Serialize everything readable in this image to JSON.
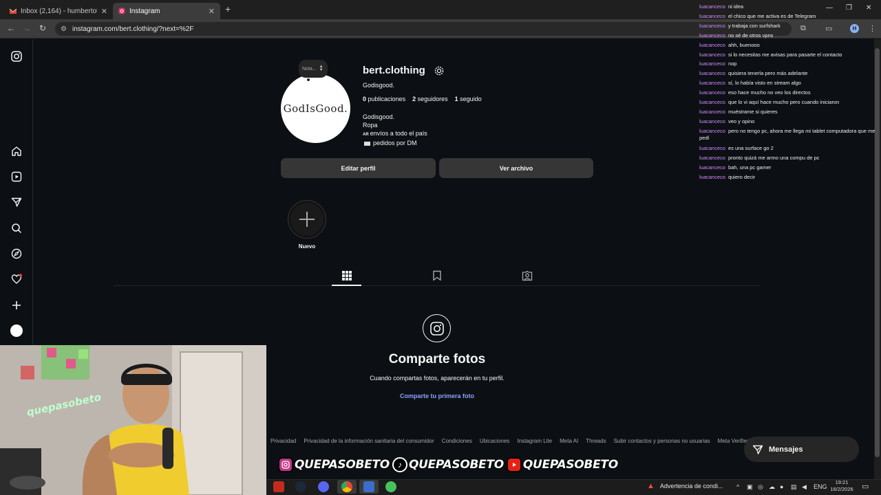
{
  "browser": {
    "tabs": [
      {
        "title": "Inbox (2,164) - humbertotutive..."
      },
      {
        "title": "Instagram"
      }
    ],
    "url": "instagram.com/bert.clothing/?next=%2F",
    "profile_initial": "H"
  },
  "profile": {
    "note": "Nota...",
    "avatar_text": "GodIsGood.",
    "username": "bert.clothing",
    "full_name": "Godisgood.",
    "stats": {
      "posts_count": "0",
      "posts_label": "publicaciones",
      "followers_count": "2",
      "followers_label": "seguidores",
      "following_count": "1",
      "following_label": "seguido"
    },
    "bio": {
      "line1": "Godisgood.",
      "line2": "Ropa",
      "flag": "AR",
      "line3": "envíos a todo el país",
      "line4": "pedidos por DM"
    },
    "edit_button": "Editar perfil",
    "archive_button": "Ver archivo",
    "new_highlight_label": "Nuevo"
  },
  "empty_state": {
    "title": "Comparte fotos",
    "subtitle": "Cuando compartas fotos, aparecerán en tu perfil.",
    "link": "Comparte tu primera foto"
  },
  "footer_links": [
    "Privacidad",
    "Privacidad de la información sanitaria del consumidor",
    "Condiciones",
    "Ubicaciones",
    "Instagram Lite",
    "Meta AI",
    "Threads",
    "Subir contactos y personas no usuarias",
    "Meta Verified"
  ],
  "messages_button": "Mensajes",
  "chat": [
    {
      "user": "luacanceco",
      "msg": "ni idea"
    },
    {
      "user": "luacanceco",
      "msg": "el chico que me activa es de Telegram"
    },
    {
      "user": "luacanceco",
      "msg": "y trabaja con surfshark"
    },
    {
      "user": "luacanceco",
      "msg": "no sé de otros vpns"
    },
    {
      "user": "luacanceco",
      "msg": "ahh, buenooo"
    },
    {
      "user": "luacanceco",
      "msg": "si lo necesitas me avisas para pasarte el contacto"
    },
    {
      "user": "luacanceco",
      "msg": "nop"
    },
    {
      "user": "luacanceco",
      "msg": "quisiera tenerla pero más adelante"
    },
    {
      "user": "luacanceco",
      "msg": "sí, lo había visto en stream algo"
    },
    {
      "user": "luacanceco",
      "msg": "eso hace mucho no veo los directos"
    },
    {
      "user": "luacanceco",
      "msg": "que lo vi aquí hace mucho pero cuando iniciaron"
    },
    {
      "user": "luacanceco",
      "msg": "muéstrame si quieres"
    },
    {
      "user": "luacanceco",
      "msg": "veo y opino"
    },
    {
      "user": "luacanceco",
      "msg": "pero no tengo pc, ahora me llega mi tablet computadora que me pedí"
    },
    {
      "user": "luacanceco",
      "msg": "es una surface go 2"
    },
    {
      "user": "luacanceco",
      "msg": "pronto quizá me armo una compu de pc"
    },
    {
      "user": "luacanceco",
      "msg": "bah, una pc gamer"
    },
    {
      "user": "luacanceco",
      "msg": "quiero decir"
    }
  ],
  "webcam": {
    "neon_sign": "quepasobeto"
  },
  "social_banner": [
    {
      "network": "instagram-icon",
      "handle": "QUEPASOBETO"
    },
    {
      "network": "tiktok-icon",
      "handle": "QUEPASOBETO"
    },
    {
      "network": "youtube-icon",
      "handle": "QUEPASOBETO"
    }
  ],
  "taskbar": {
    "warning": "Advertencia de condi...",
    "language": "ENG",
    "time": "19:21",
    "date": "16/2/2026"
  }
}
